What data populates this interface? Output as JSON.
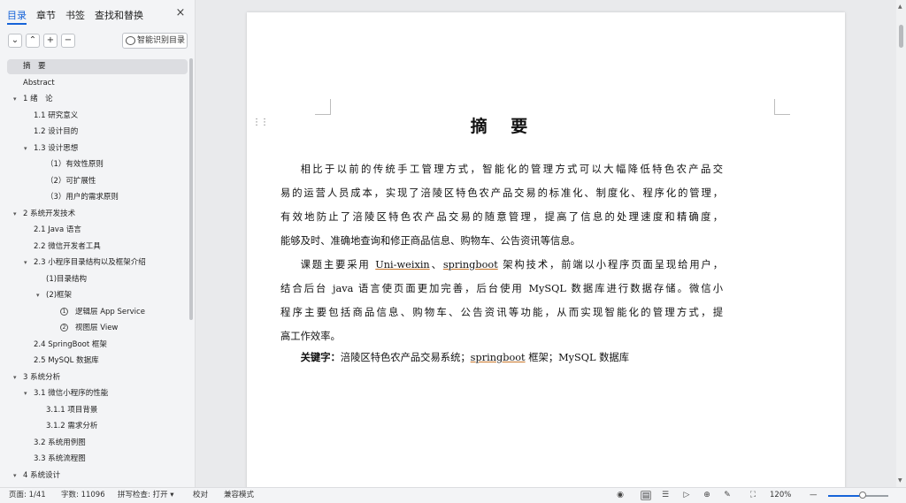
{
  "sidebar": {
    "tabs": [
      {
        "label": "目录",
        "active": true
      },
      {
        "label": "章节",
        "active": false
      },
      {
        "label": "书签",
        "active": false
      },
      {
        "label": "查找和替换",
        "active": false
      }
    ],
    "close_icon": "×",
    "toolbar": {
      "collapse_icon": "⌄",
      "expand_icon": "⌃",
      "add_icon": "+",
      "remove_icon": "−",
      "smart_toc_label": "智能识别目录"
    },
    "toc": [
      {
        "label": "摘　要",
        "level": 0,
        "caret": false,
        "selected": true
      },
      {
        "label": "Abstract",
        "level": 0,
        "caret": false
      },
      {
        "label": "1  绪　论",
        "level": 0,
        "caret": true
      },
      {
        "label": "1.1 研究意义",
        "level": 1,
        "caret": false
      },
      {
        "label": "1.2 设计目的",
        "level": 1,
        "caret": false
      },
      {
        "label": "1.3 设计思想",
        "level": 1,
        "caret": true
      },
      {
        "label": "（1）有效性原则",
        "level": 2,
        "caret": false
      },
      {
        "label": "（2）可扩展性",
        "level": 2,
        "caret": false
      },
      {
        "label": "（3）用户的需求原则",
        "level": 2,
        "caret": false
      },
      {
        "label": "2 系统开发技术",
        "level": 0,
        "caret": true
      },
      {
        "label": "2.1 Java 语言",
        "level": 1,
        "caret": false
      },
      {
        "label": "2.2 微信开发者工具",
        "level": 1,
        "caret": false
      },
      {
        "label": "2.3 小程序目录结构以及框架介绍",
        "level": 1,
        "caret": true
      },
      {
        "label": "(1)目录结构",
        "level": 2,
        "caret": false
      },
      {
        "label": "(2)框架",
        "level": 2,
        "caret": true
      },
      {
        "label": "逻辑层 App Service",
        "level": 3,
        "caret": false,
        "num": "1"
      },
      {
        "label": "视图层 View",
        "level": 3,
        "caret": false,
        "num": "2"
      },
      {
        "label": "2.4 SpringBoot 框架",
        "level": 1,
        "caret": false
      },
      {
        "label": "2.5 MySQL 数据库",
        "level": 1,
        "caret": false
      },
      {
        "label": "3 系统分析",
        "level": 0,
        "caret": true
      },
      {
        "label": "3.1 微信小程序的性能",
        "level": 1,
        "caret": true
      },
      {
        "label": "3.1.1 项目背景",
        "level": 2,
        "caret": false
      },
      {
        "label": "3.1.2 需求分析",
        "level": 2,
        "caret": false
      },
      {
        "label": "3.2 系统用例图",
        "level": 1,
        "caret": false
      },
      {
        "label": "3.3  系统流程图",
        "level": 1,
        "caret": false
      },
      {
        "label": "4  系统设计",
        "level": 0,
        "caret": true
      }
    ]
  },
  "document": {
    "title": "摘 要",
    "para1": {
      "lines": [
        "相比于以前的传统手工管理方式，智能化的管理方式可以大幅降低特色农产品交",
        "易的运营人员成本，实现了涪陵区特色农产品交易的标准化、制度化、程序化的管理，",
        "有效地防止了涪陵区特色农产品交易的随意管理，提高了信息的处理速度和精确度，",
        "能够及时、准确地查询和修正商品信息、购物车、公告资讯等信息。"
      ]
    },
    "para2": {
      "l1_a": "课题主要采用 ",
      "l1_b": "Uni-weixin",
      "l1_c": "、",
      "l1_d": "springboot",
      "l1_e": " 架构技术，前端以小程序页面呈现给用户，",
      "l2": "结合后台 java 语言使页面更加完善，后台使用 MySQL 数据库进行数据存储。微信小",
      "l3": "程序主要包括商品信息、购物车、公告资讯等功能，从而实现智能化的管理方式，提",
      "l4": "高工作效率。"
    },
    "keywords": {
      "label": "关键字：",
      "a": "涪陵区特色农产品交易系统；",
      "b": "springboot",
      "c": " 框架；MySQL 数据库"
    }
  },
  "status": {
    "page": "页面: 1/41",
    "words": "字数: 11096",
    "spellcheck": "拼写检查: 打开",
    "spellcheck_caret": "▾",
    "proofread": "校对",
    "compat": "兼容模式",
    "zoom": "120%",
    "zoom_minus": "—",
    "zoom_level": 0.57
  }
}
